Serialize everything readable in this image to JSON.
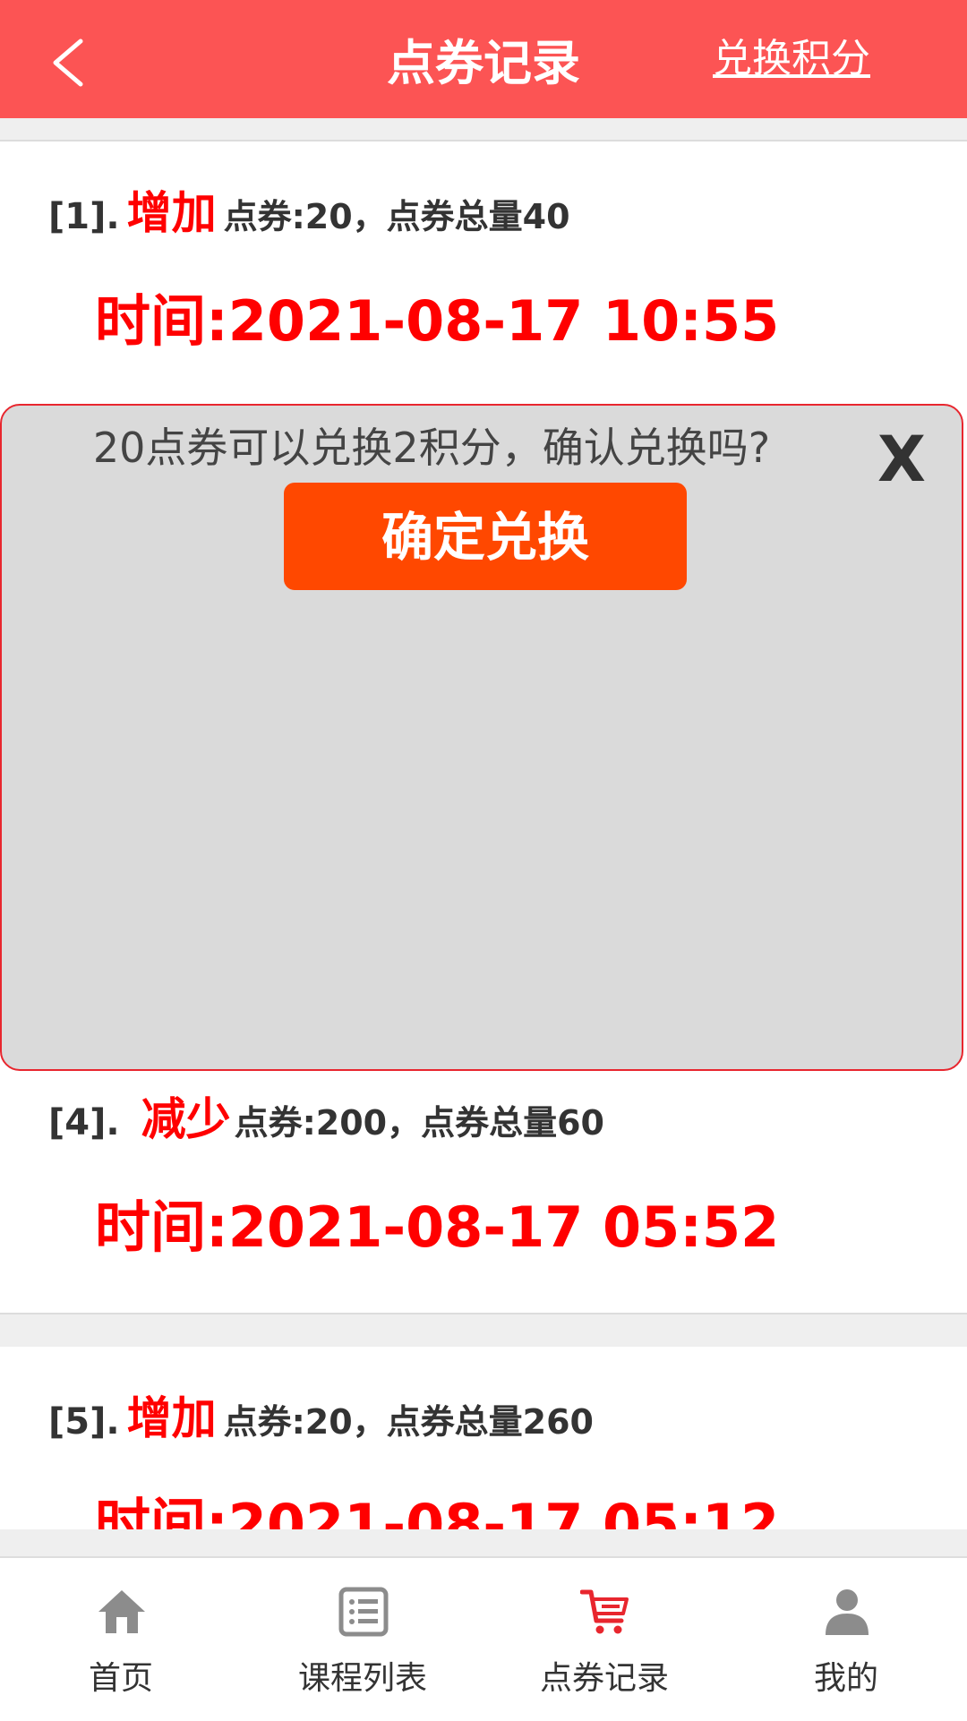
{
  "header": {
    "title": "点券记录",
    "exchange_link": "兑换积分"
  },
  "records": [
    {
      "index": "[1].",
      "action": "增加",
      "detail": "点券:20，点券总量40",
      "time": "时间:2021-08-17 10:55"
    },
    {
      "index": "[4].",
      "action": "减少",
      "detail": "点券:200，点券总量60",
      "time": "时间:2021-08-17 05:52"
    },
    {
      "index": "[5].",
      "action": "增加",
      "detail": "点券:20，点券总量260",
      "time": "时间:2021-08-17 05:12"
    }
  ],
  "modal": {
    "message": "20点券可以兑换2积分，确认兑换吗?",
    "close_label": "X",
    "confirm_label": "确定兑换"
  },
  "bottom_nav": [
    {
      "label": "首页",
      "icon": "home-icon",
      "active": false
    },
    {
      "label": "课程列表",
      "icon": "list-icon",
      "active": false
    },
    {
      "label": "点券记录",
      "icon": "cart-icon",
      "active": true
    },
    {
      "label": "我的",
      "icon": "user-icon",
      "active": false
    }
  ],
  "colors": {
    "header_bg": "#fc5454",
    "accent_red": "#ff0000",
    "confirm_button": "#ff4800",
    "modal_bg": "#dadada",
    "active_nav": "#e8262e"
  }
}
